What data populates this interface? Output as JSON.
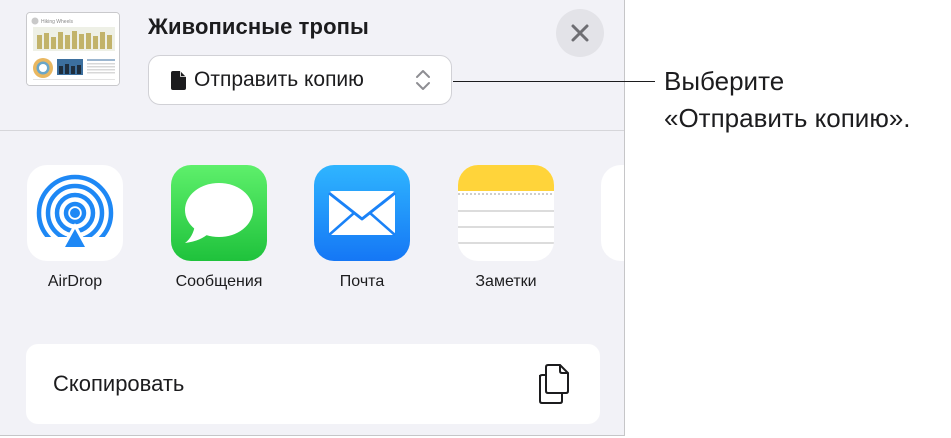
{
  "header": {
    "document_title": "Живописные тропы",
    "thumbnail_caption": "Hiking Wheels",
    "close_icon": "xmark-icon"
  },
  "send_option": {
    "label": "Отправить копию",
    "doc_icon": "document-icon",
    "chevron_icon": "chevron-up-down-icon"
  },
  "apps": [
    {
      "label": "AirDrop",
      "icon": "airdrop-icon"
    },
    {
      "label": "Сообщения",
      "icon": "messages-icon"
    },
    {
      "label": "Почта",
      "icon": "mail-icon"
    },
    {
      "label": "Заметки",
      "icon": "notes-icon"
    }
  ],
  "actions": {
    "copy_label": "Скопировать",
    "copy_icon": "copy-icon"
  },
  "callout": {
    "line1": "Выберите",
    "line2": "«Отправить копию»."
  },
  "colors": {
    "sheet_background": "#f2f2f7",
    "messages_green": "#2bd44a",
    "mail_blue": "#1d8cf8",
    "notes_yellow": "#ffd43a",
    "airdrop_blue": "#1e88f5"
  }
}
